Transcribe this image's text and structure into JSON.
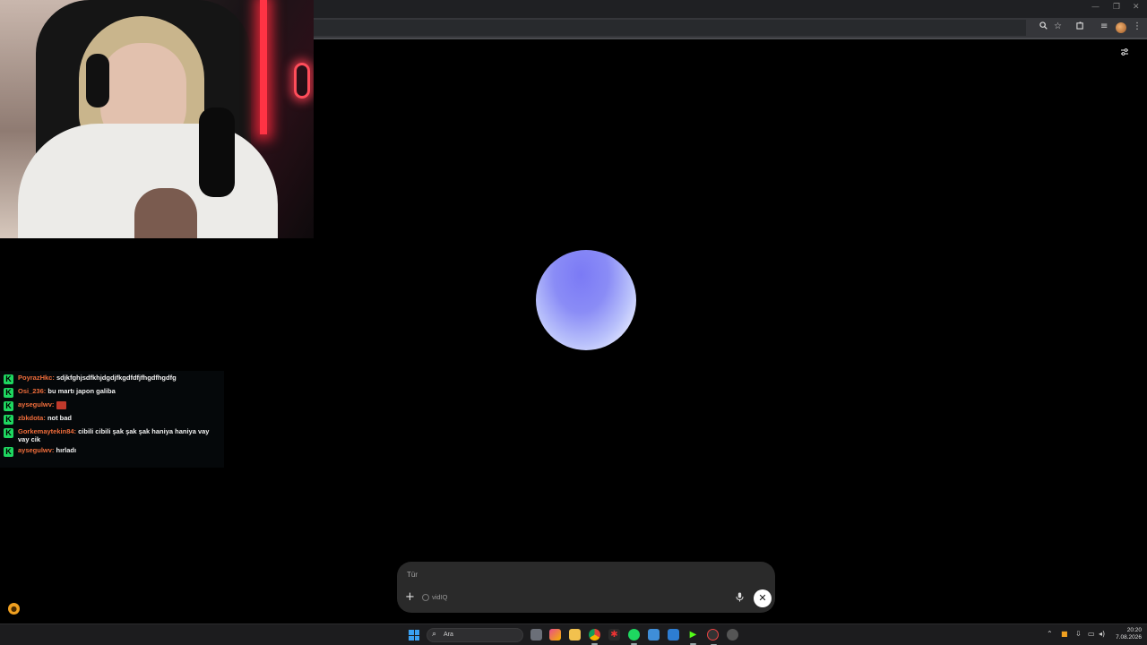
{
  "browser": {
    "window_controls": {
      "minimize": "—",
      "restore": "❐",
      "close": "✕"
    },
    "toolbar_icons": [
      "zoom-icon",
      "star-icon",
      "extensions-icon",
      "media-icon",
      "profile-avatar",
      "menu-icon"
    ]
  },
  "chat": {
    "messages": [
      {
        "user": "PoyrazHkc:",
        "text": "sdjkfghjsdfkhjdgdjfkgdfdfjfhgdfhgdfg"
      },
      {
        "user": "Osi_236:",
        "text": "bu martı japon galiba"
      },
      {
        "user": "aysegulwv:",
        "text": "",
        "emote": true
      },
      {
        "user": "zbkdota:",
        "text": "not bad"
      },
      {
        "user": "Gorkemaytekin84:",
        "text": "cibili cibili şak şak şak haniya haniya vay vay cik"
      },
      {
        "user": "aysegulwv:",
        "text": "hırladı"
      }
    ],
    "badge_glyph": "K"
  },
  "composer": {
    "placeholder": "Tür",
    "chip_label": "vidIQ",
    "plus": "+",
    "close": "✕"
  },
  "taskbar": {
    "search_placeholder": "Ara",
    "clock_time": "20:20",
    "clock_date": "7.08.2026"
  },
  "colors": {
    "chat_username": "#f06d3b",
    "badge": "#1ed760",
    "orb_top": "#7b7af5",
    "orb_bottom": "#ffffff"
  }
}
